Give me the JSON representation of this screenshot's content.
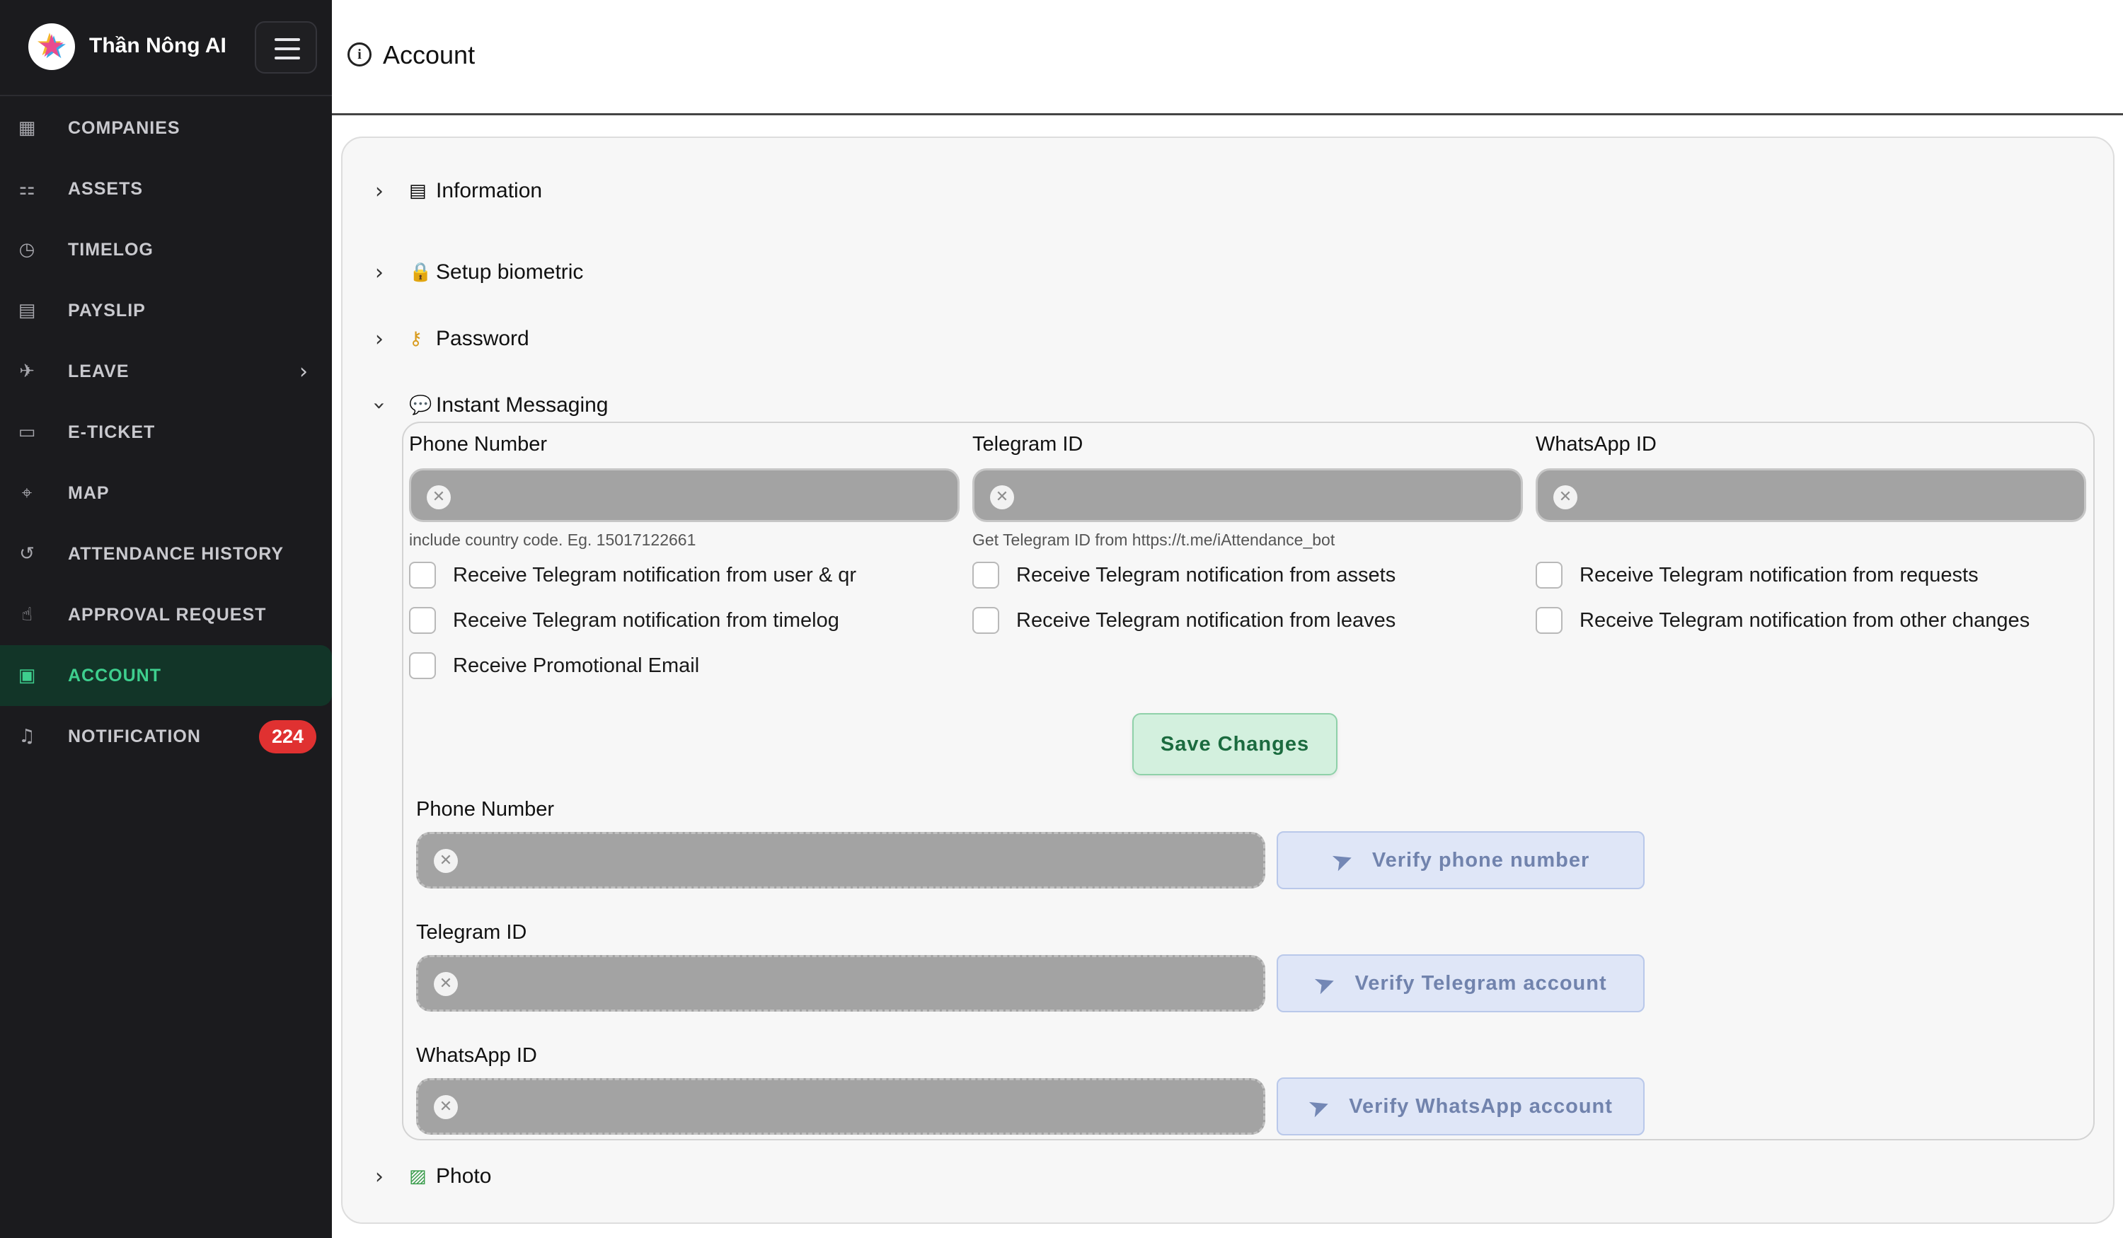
{
  "app": {
    "name": "Thần Nông AI"
  },
  "sidebar": {
    "items": [
      {
        "label": "COMPANIES",
        "icon": "building-icon"
      },
      {
        "label": "ASSETS",
        "icon": "hierarchy-icon"
      },
      {
        "label": "TIMELOG",
        "icon": "clock-icon"
      },
      {
        "label": "PAYSLIP",
        "icon": "receipt-icon"
      },
      {
        "label": "LEAVE",
        "icon": "plane-icon",
        "has_submenu": true
      },
      {
        "label": "E-TICKET",
        "icon": "ticket-icon"
      },
      {
        "label": "MAP",
        "icon": "map-icon"
      },
      {
        "label": "ATTENDANCE HISTORY",
        "icon": "history-icon"
      },
      {
        "label": "APPROVAL REQUEST",
        "icon": "thumbs-up-icon"
      },
      {
        "label": "ACCOUNT",
        "icon": "id-card-icon",
        "active": true
      },
      {
        "label": "NOTIFICATION",
        "icon": "bell-icon",
        "badge": "224"
      }
    ],
    "accent": "#3ecf8e"
  },
  "header": {
    "title": "Account"
  },
  "sections": {
    "information": "Information",
    "biometric": "Setup biometric",
    "password": "Password",
    "messaging": "Instant Messaging",
    "photo": "Photo"
  },
  "messaging": {
    "phone_label": "Phone Number",
    "telegram_label": "Telegram ID",
    "whatsapp_label": "WhatsApp ID",
    "phone_help": "include country code. Eg. 15017122661",
    "telegram_help": "Get Telegram ID from https://t.me/iAttendance_bot",
    "checkboxes": [
      "Receive Telegram notification from user & qr",
      "Receive Telegram notification from assets",
      "Receive Telegram notification from requests",
      "Receive Telegram notification from timelog",
      "Receive Telegram notification from leaves",
      "Receive Telegram notification from other changes",
      "Receive Promotional Email"
    ],
    "save_label": "Save Changes",
    "verify": {
      "phone_label": "Phone Number",
      "telegram_label": "Telegram ID",
      "whatsapp_label": "WhatsApp ID",
      "verify_phone": "Verify phone number",
      "verify_telegram": "Verify Telegram account",
      "verify_whatsapp": "Verify WhatsApp account"
    }
  },
  "colors": {
    "save_bg": "#d3f0de",
    "verify_bg": "#dfe6f7",
    "badge": "#e03131"
  }
}
